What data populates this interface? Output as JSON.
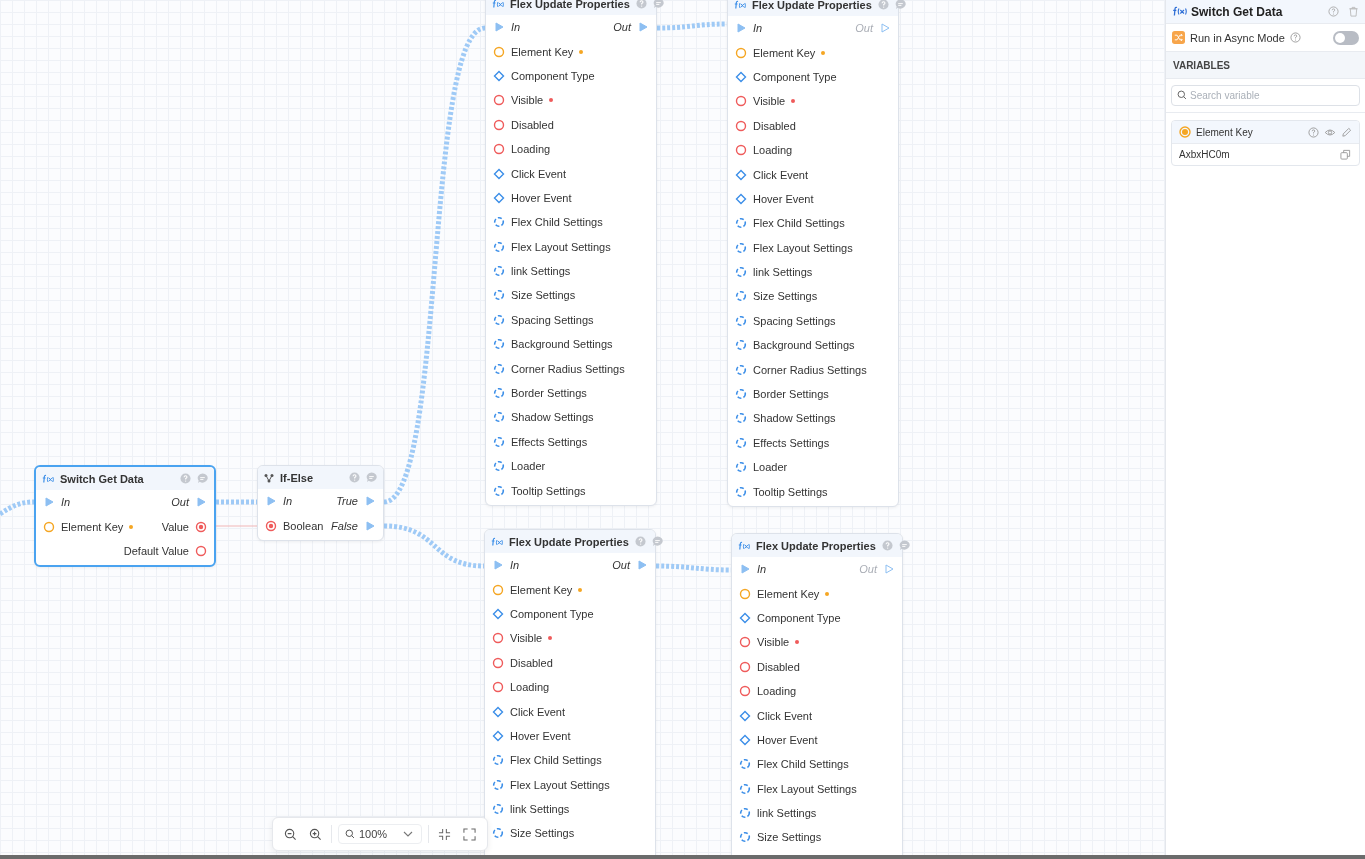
{
  "nodes": [
    {
      "title": "Switch Get Data",
      "selected": true,
      "cut_off": false,
      "rows": [
        {
          "left": {
            "label": "In",
            "kind": "exec",
            "connected": true
          },
          "right": {
            "label": "Out",
            "kind": "exec",
            "connected": true
          }
        },
        {
          "left": {
            "label": "Element Key",
            "kind": "key",
            "required": true
          },
          "right": {
            "label": "Value",
            "kind": "bool",
            "connected": true
          }
        },
        {
          "right": {
            "label": "Default Value",
            "kind": "bool",
            "connected": false
          }
        }
      ]
    },
    {
      "title": "If-Else",
      "selected": false,
      "cut_off": false,
      "rows": [
        {
          "left": {
            "label": "In",
            "kind": "exec",
            "connected": true
          },
          "right": {
            "label": "True",
            "kind": "exec",
            "connected": true
          }
        },
        {
          "left": {
            "label": "Boolean",
            "kind": "bool",
            "connected": true
          },
          "right": {
            "label": "False",
            "kind": "exec",
            "connected": true
          }
        }
      ]
    },
    {
      "title": "Flex Update Properties",
      "selected": false,
      "cut_off": false,
      "rows": [
        {
          "left": {
            "label": "In",
            "kind": "exec",
            "connected": true
          },
          "right": {
            "label": "Out",
            "kind": "exec",
            "connected": true
          }
        },
        {
          "left": {
            "label": "Element Key",
            "kind": "key",
            "required": true
          }
        },
        {
          "left": {
            "label": "Component Type",
            "kind": "type"
          }
        },
        {
          "left": {
            "label": "Visible",
            "kind": "bool",
            "connected": false,
            "required": true
          }
        },
        {
          "left": {
            "label": "Disabled",
            "kind": "bool",
            "connected": false
          }
        },
        {
          "left": {
            "label": "Loading",
            "kind": "bool",
            "connected": false
          }
        },
        {
          "left": {
            "label": "Click Event",
            "kind": "type"
          }
        },
        {
          "left": {
            "label": "Hover Event",
            "kind": "type"
          }
        },
        {
          "left": {
            "label": "Flex Child Settings",
            "kind": "settings"
          }
        },
        {
          "left": {
            "label": "Flex Layout Settings",
            "kind": "settings"
          }
        },
        {
          "left": {
            "label": "link Settings",
            "kind": "settings"
          }
        },
        {
          "left": {
            "label": "Size Settings",
            "kind": "settings"
          }
        },
        {
          "left": {
            "label": "Spacing Settings",
            "kind": "settings"
          }
        },
        {
          "left": {
            "label": "Background Settings",
            "kind": "settings"
          }
        },
        {
          "left": {
            "label": "Corner Radius Settings",
            "kind": "settings"
          }
        },
        {
          "left": {
            "label": "Border Settings",
            "kind": "settings"
          }
        },
        {
          "left": {
            "label": "Shadow Settings",
            "kind": "settings"
          }
        },
        {
          "left": {
            "label": "Effects Settings",
            "kind": "settings"
          }
        },
        {
          "left": {
            "label": "Loader",
            "kind": "settings"
          }
        },
        {
          "left": {
            "label": "Tooltip Settings",
            "kind": "settings"
          }
        }
      ]
    },
    {
      "title": "Flex Update Properties",
      "selected": false,
      "cut_off": false,
      "rows": [
        {
          "left": {
            "label": "In",
            "kind": "exec",
            "connected": true
          },
          "right": {
            "label": "Out",
            "kind": "exec",
            "connected": false
          }
        },
        {
          "left": {
            "label": "Element Key",
            "kind": "key",
            "required": true
          }
        },
        {
          "left": {
            "label": "Component Type",
            "kind": "type"
          }
        },
        {
          "left": {
            "label": "Visible",
            "kind": "bool",
            "connected": false,
            "required": true
          }
        },
        {
          "left": {
            "label": "Disabled",
            "kind": "bool",
            "connected": false
          }
        },
        {
          "left": {
            "label": "Loading",
            "kind": "bool",
            "connected": false
          }
        },
        {
          "left": {
            "label": "Click Event",
            "kind": "type"
          }
        },
        {
          "left": {
            "label": "Hover Event",
            "kind": "type"
          }
        },
        {
          "left": {
            "label": "Flex Child Settings",
            "kind": "settings"
          }
        },
        {
          "left": {
            "label": "Flex Layout Settings",
            "kind": "settings"
          }
        },
        {
          "left": {
            "label": "link Settings",
            "kind": "settings"
          }
        },
        {
          "left": {
            "label": "Size Settings",
            "kind": "settings"
          }
        },
        {
          "left": {
            "label": "Spacing Settings",
            "kind": "settings"
          }
        },
        {
          "left": {
            "label": "Background Settings",
            "kind": "settings"
          }
        },
        {
          "left": {
            "label": "Corner Radius Settings",
            "kind": "settings"
          }
        },
        {
          "left": {
            "label": "Border Settings",
            "kind": "settings"
          }
        },
        {
          "left": {
            "label": "Shadow Settings",
            "kind": "settings"
          }
        },
        {
          "left": {
            "label": "Effects Settings",
            "kind": "settings"
          }
        },
        {
          "left": {
            "label": "Loader",
            "kind": "settings"
          }
        },
        {
          "left": {
            "label": "Tooltip Settings",
            "kind": "settings"
          }
        }
      ]
    },
    {
      "title": "Flex Update Properties",
      "selected": false,
      "cut_off": true,
      "rows": [
        {
          "left": {
            "label": "In",
            "kind": "exec",
            "connected": true
          },
          "right": {
            "label": "Out",
            "kind": "exec",
            "connected": true
          }
        },
        {
          "left": {
            "label": "Element Key",
            "kind": "key",
            "required": true
          }
        },
        {
          "left": {
            "label": "Component Type",
            "kind": "type"
          }
        },
        {
          "left": {
            "label": "Visible",
            "kind": "bool",
            "connected": false,
            "required": true
          }
        },
        {
          "left": {
            "label": "Disabled",
            "kind": "bool",
            "connected": false
          }
        },
        {
          "left": {
            "label": "Loading",
            "kind": "bool",
            "connected": false
          }
        },
        {
          "left": {
            "label": "Click Event",
            "kind": "type"
          }
        },
        {
          "left": {
            "label": "Hover Event",
            "kind": "type"
          }
        },
        {
          "left": {
            "label": "Flex Child Settings",
            "kind": "settings"
          }
        },
        {
          "left": {
            "label": "Flex Layout Settings",
            "kind": "settings"
          }
        },
        {
          "left": {
            "label": "link Settings",
            "kind": "settings"
          }
        },
        {
          "left": {
            "label": "Size Settings",
            "kind": "settings"
          }
        }
      ]
    },
    {
      "title": "Flex Update Properties",
      "selected": false,
      "cut_off": true,
      "rows": [
        {
          "left": {
            "label": "In",
            "kind": "exec",
            "connected": true
          },
          "right": {
            "label": "Out",
            "kind": "exec",
            "connected": false
          }
        },
        {
          "left": {
            "label": "Element Key",
            "kind": "key",
            "required": true
          }
        },
        {
          "left": {
            "label": "Component Type",
            "kind": "type"
          }
        },
        {
          "left": {
            "label": "Visible",
            "kind": "bool",
            "connected": false,
            "required": true
          }
        },
        {
          "left": {
            "label": "Disabled",
            "kind": "bool",
            "connected": false
          }
        },
        {
          "left": {
            "label": "Loading",
            "kind": "bool",
            "connected": false
          }
        },
        {
          "left": {
            "label": "Click Event",
            "kind": "type"
          }
        },
        {
          "left": {
            "label": "Hover Event",
            "kind": "type"
          }
        },
        {
          "left": {
            "label": "Flex Child Settings",
            "kind": "settings"
          }
        },
        {
          "left": {
            "label": "Flex Layout Settings",
            "kind": "settings"
          }
        },
        {
          "left": {
            "label": "link Settings",
            "kind": "settings"
          }
        },
        {
          "left": {
            "label": "Size Settings",
            "kind": "settings"
          }
        }
      ]
    }
  ],
  "zoom_bar": {
    "zoom": "100%"
  },
  "panel": {
    "title": "Switch Get Data",
    "async": {
      "label": "Run in Async Mode",
      "on": false
    },
    "section": "VARIABLES",
    "search": {
      "placeholder": "Search variable"
    },
    "variables": [
      {
        "name": "Element Key",
        "value": "AxbxHC0m"
      }
    ]
  }
}
